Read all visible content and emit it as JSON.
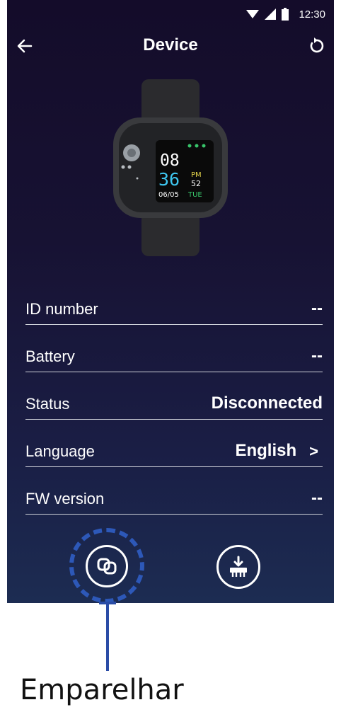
{
  "status_bar": {
    "time": "12:30"
  },
  "app_bar": {
    "title": "Device"
  },
  "watch_face": {
    "hour": "08",
    "minute": "36",
    "ampm": "PM",
    "seconds": "52",
    "date": "06/05",
    "weekday": "TUE"
  },
  "rows": [
    {
      "label": "ID number",
      "value": "--"
    },
    {
      "label": "Battery",
      "value": "--"
    },
    {
      "label": "Status",
      "value": "Disconnected"
    },
    {
      "label": "Language",
      "value": "English",
      "chevron": ">"
    },
    {
      "label": "FW version",
      "value": "--"
    }
  ],
  "actions": {
    "pair_icon": "link-icon",
    "update_icon": "firmware-update-icon"
  },
  "annotation": {
    "label": "Emparelhar",
    "color": "#2a4ca6"
  }
}
